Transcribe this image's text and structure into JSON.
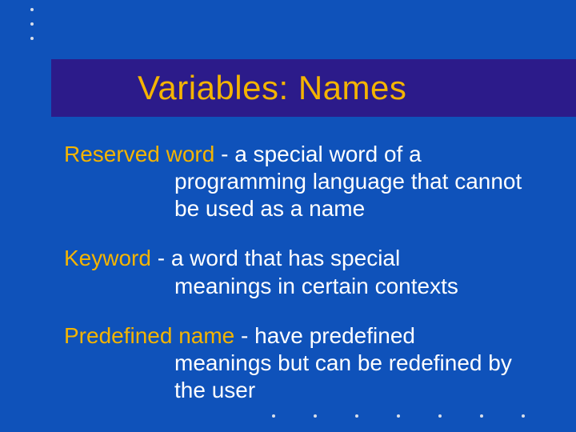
{
  "title": "Variables:  Names",
  "items": [
    {
      "term": "Reserved word",
      "def_first": " - a special word of a",
      "def_rest": "programming language that cannot be used as a name"
    },
    {
      "term": "Keyword",
      "def_first": " - a word that has special",
      "def_rest": "meanings in certain contexts"
    },
    {
      "term": "Predefined name",
      "def_first": " - have predefined",
      "def_rest": "meanings but can be redefined by the user"
    }
  ]
}
